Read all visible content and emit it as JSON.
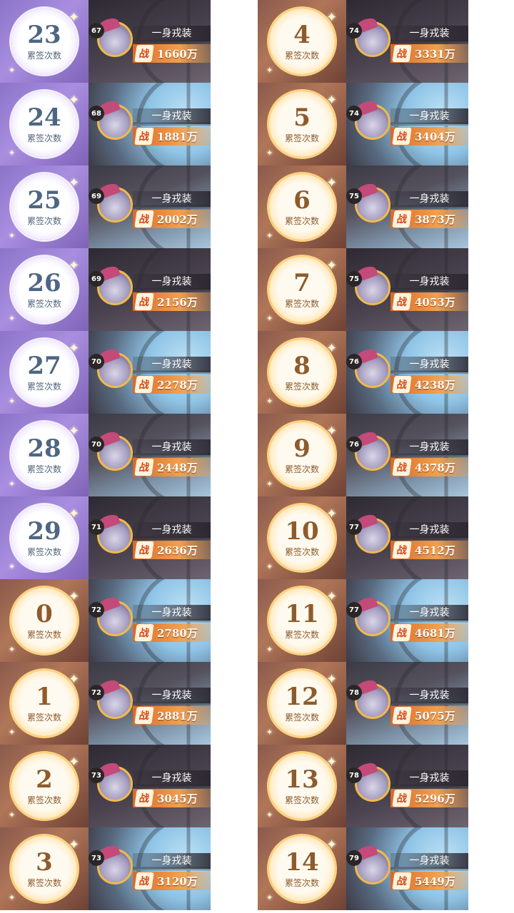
{
  "label": "累签次数",
  "name": "一身戎装",
  "power_prefix": "战",
  "left_column": [
    {
      "count": "23",
      "level": "67",
      "power": "1660万",
      "theme": "purple"
    },
    {
      "count": "24",
      "level": "68",
      "power": "1881万",
      "theme": "purple"
    },
    {
      "count": "25",
      "level": "69",
      "power": "2002万",
      "theme": "purple"
    },
    {
      "count": "26",
      "level": "69",
      "power": "2156万",
      "theme": "purple"
    },
    {
      "count": "27",
      "level": "70",
      "power": "2278万",
      "theme": "purple"
    },
    {
      "count": "28",
      "level": "70",
      "power": "2448万",
      "theme": "purple"
    },
    {
      "count": "29",
      "level": "71",
      "power": "2636万",
      "theme": "purple"
    },
    {
      "count": "0",
      "level": "72",
      "power": "2780万",
      "theme": "gold"
    },
    {
      "count": "1",
      "level": "72",
      "power": "2881万",
      "theme": "gold"
    },
    {
      "count": "2",
      "level": "73",
      "power": "3045万",
      "theme": "gold"
    },
    {
      "count": "3",
      "level": "73",
      "power": "3120万",
      "theme": "gold"
    }
  ],
  "right_column": [
    {
      "count": "4",
      "level": "74",
      "power": "3331万",
      "theme": "gold"
    },
    {
      "count": "5",
      "level": "74",
      "power": "3404万",
      "theme": "gold"
    },
    {
      "count": "6",
      "level": "75",
      "power": "3873万",
      "theme": "gold"
    },
    {
      "count": "7",
      "level": "75",
      "power": "4053万",
      "theme": "gold"
    },
    {
      "count": "8",
      "level": "76",
      "power": "4238万",
      "theme": "gold"
    },
    {
      "count": "9",
      "level": "76",
      "power": "4378万",
      "theme": "gold"
    },
    {
      "count": "10",
      "level": "77",
      "power": "4512万",
      "theme": "gold"
    },
    {
      "count": "11",
      "level": "77",
      "power": "4681万",
      "theme": "gold"
    },
    {
      "count": "12",
      "level": "78",
      "power": "5075万",
      "theme": "gold"
    },
    {
      "count": "13",
      "level": "78",
      "power": "5296万",
      "theme": "gold"
    },
    {
      "count": "14",
      "level": "79",
      "power": "5449万",
      "theme": "gold"
    }
  ],
  "colors": {
    "purple_panel": "#9a82d6",
    "gold_panel": "#f6b95c",
    "power_bar": "#e8853a",
    "level_badge": "#2a2628"
  }
}
